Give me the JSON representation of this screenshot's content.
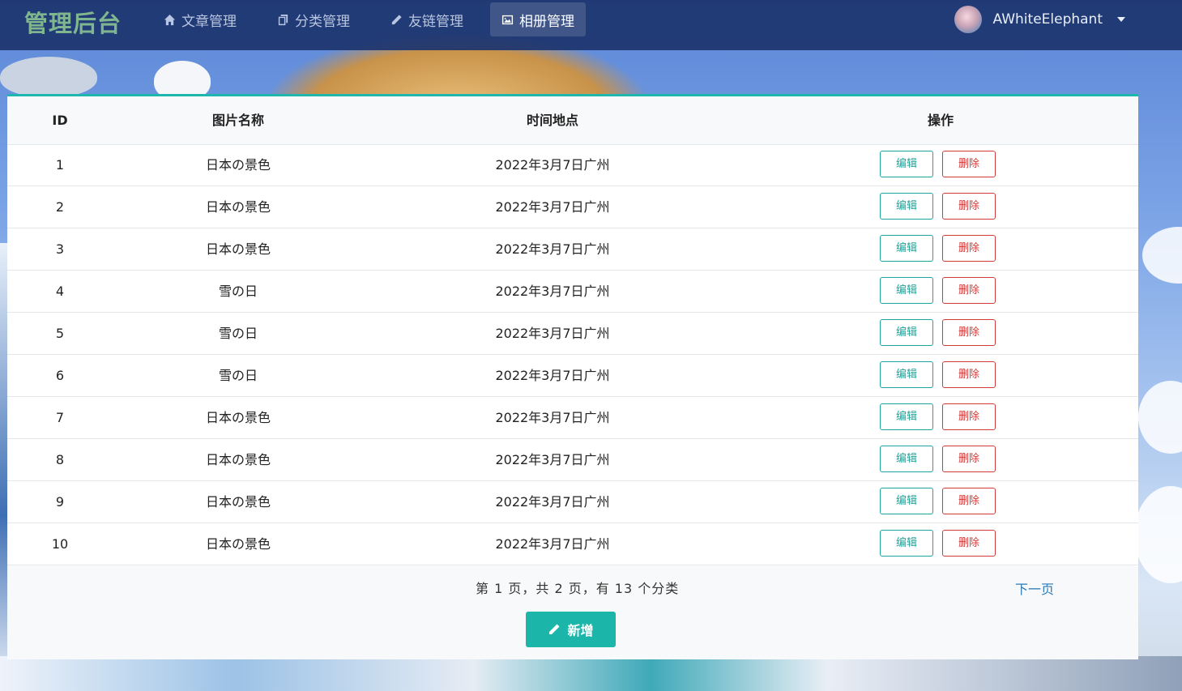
{
  "brand": "管理后台",
  "nav": [
    {
      "label": "文章管理",
      "icon": "home-icon",
      "active": false
    },
    {
      "label": "分类管理",
      "icon": "copy-icon",
      "active": false
    },
    {
      "label": "友链管理",
      "icon": "pencil-icon",
      "active": false
    },
    {
      "label": "相册管理",
      "icon": "image-icon",
      "active": true
    }
  ],
  "user": {
    "name": "AWhiteElephant"
  },
  "table": {
    "headers": {
      "id": "ID",
      "name": "图片名称",
      "place": "时间地点",
      "ops": "操作"
    },
    "edit_label": "编辑",
    "delete_label": "删除",
    "rows": [
      {
        "id": "1",
        "name": "日本の景色",
        "place": "2022年3月7日广州"
      },
      {
        "id": "2",
        "name": "日本の景色",
        "place": "2022年3月7日广州"
      },
      {
        "id": "3",
        "name": "日本の景色",
        "place": "2022年3月7日广州"
      },
      {
        "id": "4",
        "name": "雪の日",
        "place": "2022年3月7日广州"
      },
      {
        "id": "5",
        "name": "雪の日",
        "place": "2022年3月7日广州"
      },
      {
        "id": "6",
        "name": "雪の日",
        "place": "2022年3月7日广州"
      },
      {
        "id": "7",
        "name": "日本の景色",
        "place": "2022年3月7日广州"
      },
      {
        "id": "8",
        "name": "日本の景色",
        "place": "2022年3月7日广州"
      },
      {
        "id": "9",
        "name": "日本の景色",
        "place": "2022年3月7日广州"
      },
      {
        "id": "10",
        "name": "日本の景色",
        "place": "2022年3月7日广州"
      }
    ]
  },
  "pager": {
    "info": "第 1 页，共 2 页，有 13 个分类",
    "next": "下一页"
  },
  "add_button": {
    "label": "新增",
    "icon": "pencil-icon"
  },
  "colors": {
    "accent": "#1bb5aa",
    "danger": "#d23a3a",
    "nav_bg": "#1c346e",
    "brand": "#7fb58f"
  }
}
